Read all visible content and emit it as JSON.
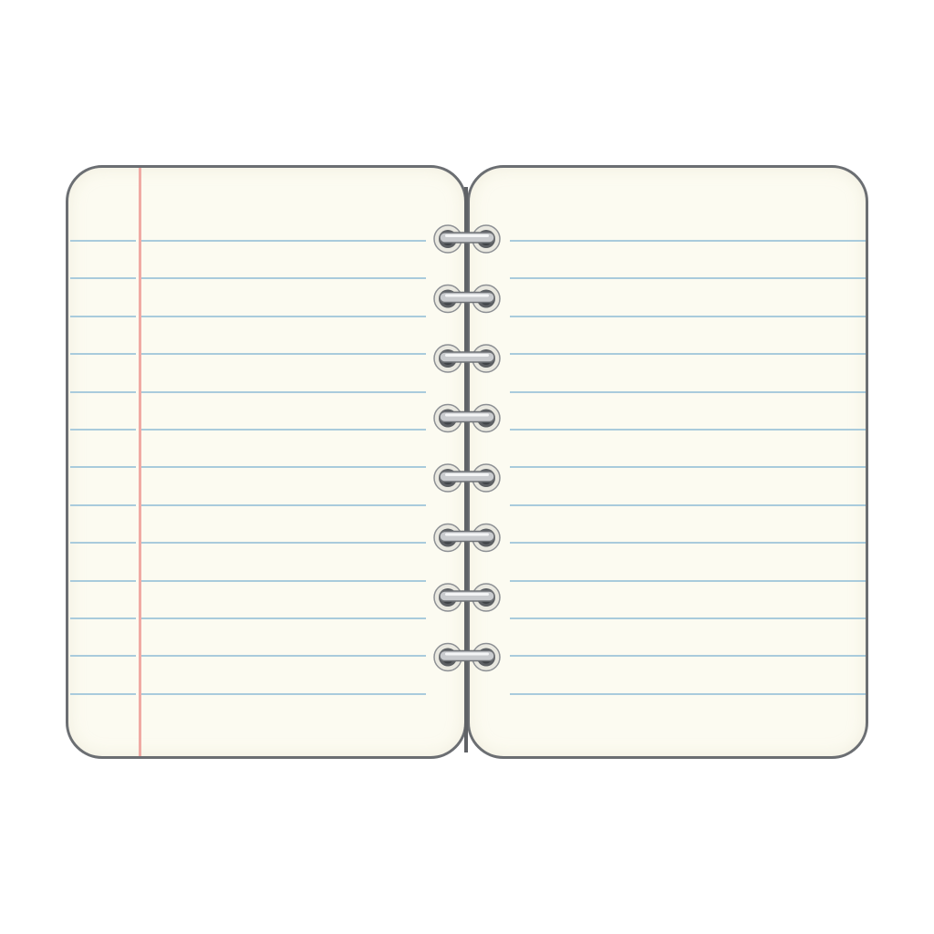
{
  "notebook": {
    "ring_count": 8,
    "left_page_rule_count": 13,
    "right_page_rule_count": 13,
    "colors": {
      "paper": "#fcfbf1",
      "rule": "#a9cbdc",
      "margin_line": "#f0aaa4",
      "border": "#6b6e72",
      "ring": "#9a9da1"
    }
  }
}
